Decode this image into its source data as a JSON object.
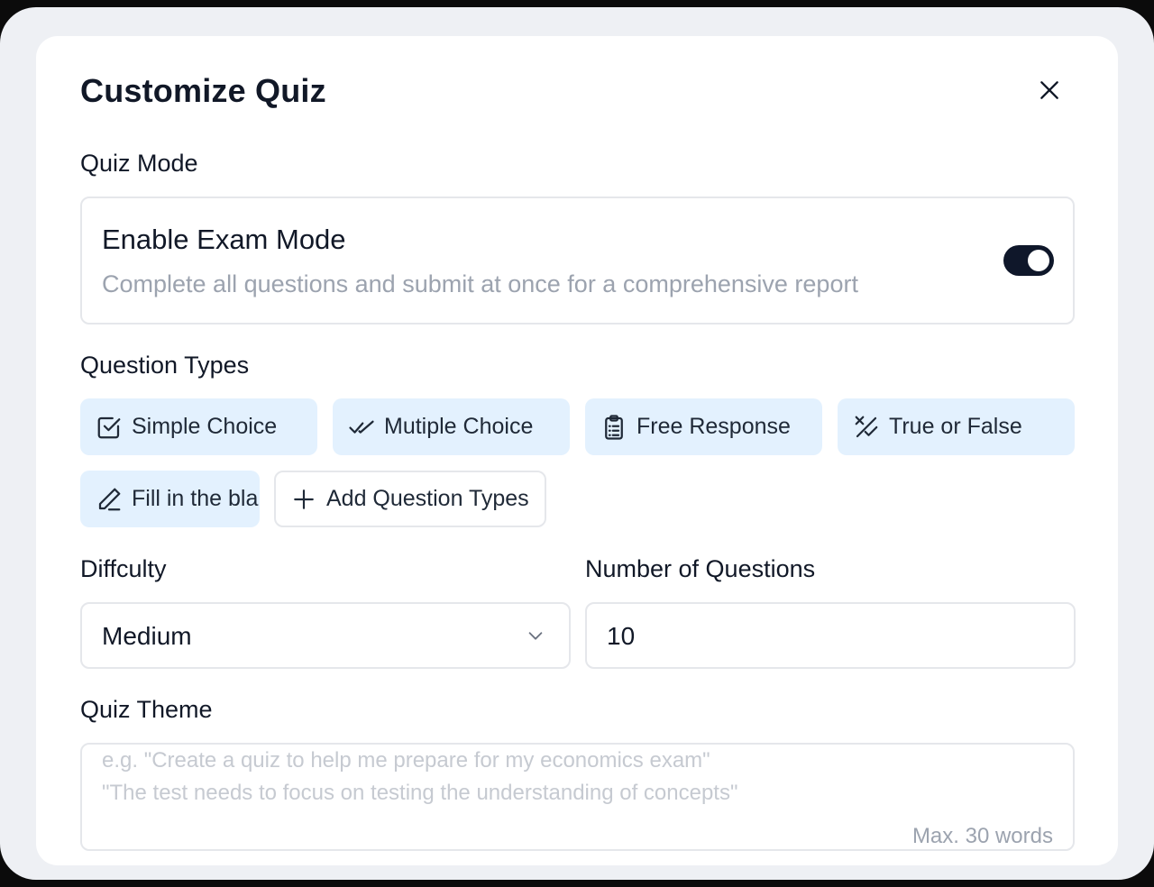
{
  "dialog": {
    "title": "Customize Quiz",
    "close_icon": "close-icon"
  },
  "quiz_mode": {
    "label": "Quiz Mode",
    "exam_mode_title": "Enable Exam Mode",
    "exam_mode_description": "Complete all questions and submit at once for a comprehensive report",
    "exam_mode_enabled": true
  },
  "question_types": {
    "label": "Question Types",
    "items": [
      {
        "label": "Simple Choice",
        "icon": "checkbox-icon",
        "selected": true
      },
      {
        "label": "Mutiple Choice",
        "icon": "double-check-icon",
        "selected": true
      },
      {
        "label": "Free Response",
        "icon": "clipboard-list-icon",
        "selected": true
      },
      {
        "label": "True or False",
        "icon": "check-x-icon",
        "selected": true
      },
      {
        "label": "Fill in the blank",
        "icon": "pencil-icon",
        "selected": true
      }
    ],
    "add_label": "Add Question Types",
    "add_icon": "plus-icon"
  },
  "difficulty": {
    "label": "Diffculty",
    "value": "Medium",
    "icon": "chevron-down-icon"
  },
  "number_of_questions": {
    "label": "Number of Questions",
    "value": "10"
  },
  "quiz_theme": {
    "label": "Quiz Theme",
    "placeholder_line1": "e.g. \"Create a quiz to help me prepare for my economics exam\"",
    "placeholder_line2": "\"The test needs to focus on testing the understanding of concepts\"",
    "limit": "Max. 30 words"
  },
  "colors": {
    "chip_background": "#e3f1fe",
    "toggle_on": "#0f172a",
    "border": "#e5e7eb",
    "text_primary": "#111827",
    "text_muted": "#9ca3af"
  }
}
